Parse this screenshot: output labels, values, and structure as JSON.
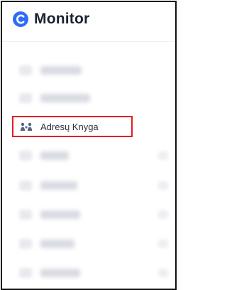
{
  "app": {
    "name": "Monitor",
    "brand_color": "#2f6df6",
    "logo_icon": "monitor-logo-icon"
  },
  "sidebar": {
    "active_item": {
      "label": "Adresų Knyga",
      "icon": "address-book-icon",
      "highlight_color": "#e31b23"
    }
  }
}
